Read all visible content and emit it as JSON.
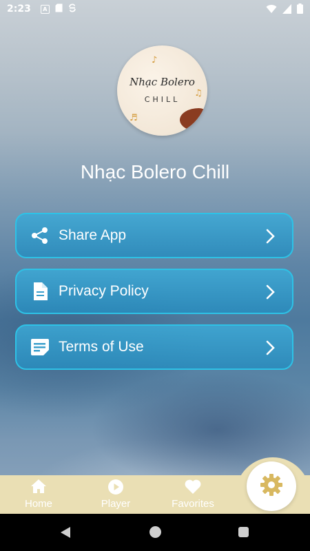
{
  "status_bar": {
    "time": "2:23",
    "left_icons": [
      "text-icon",
      "sim-card-icon",
      "sync-icon"
    ],
    "right_icons": [
      "wifi-icon",
      "signal-icon",
      "battery-icon"
    ]
  },
  "logo": {
    "script_text": "Nhạc Bolero",
    "sub_text": "CHILL"
  },
  "app_title": "Nhạc Bolero Chill",
  "menu": {
    "items": [
      {
        "label": "Share App",
        "icon": "share-icon"
      },
      {
        "label": "Privacy Policy",
        "icon": "document-icon"
      },
      {
        "label": "Terms of Use",
        "icon": "note-icon"
      }
    ]
  },
  "bottom_nav": {
    "items": [
      {
        "label": "Home",
        "icon": "home-icon"
      },
      {
        "label": "Player",
        "icon": "play-icon"
      },
      {
        "label": "Favorites",
        "icon": "heart-icon"
      }
    ],
    "active": "settings-icon"
  },
  "colors": {
    "accent_border": "#2ec2e6",
    "nav_background": "#eadfb4",
    "settings_icon": "#d8b860"
  }
}
